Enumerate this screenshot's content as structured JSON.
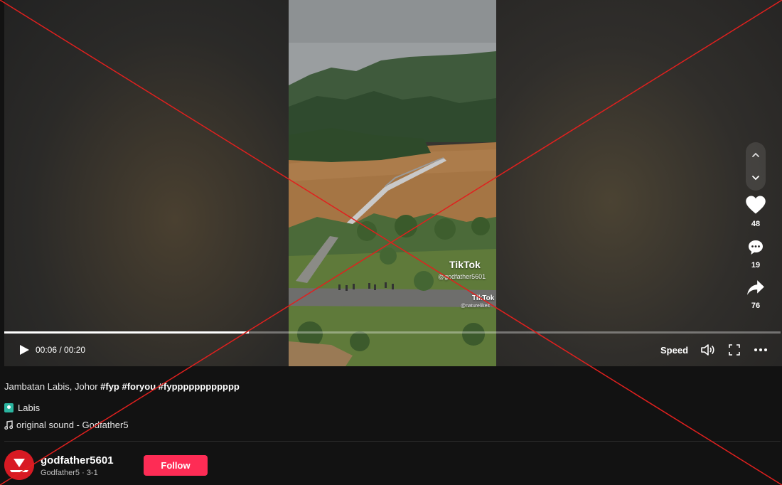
{
  "video": {
    "watermark_primary": "TikTok",
    "watermark_primary_handle": "@godfather5601",
    "watermark_secondary": "TikTok",
    "watermark_secondary_handle": "@naturelikeit",
    "progress_fraction": 0.315
  },
  "actions": {
    "likes": "48",
    "comments": "19",
    "shares": "76"
  },
  "controls": {
    "time": "00:06 / 00:20",
    "speed_label": "Speed"
  },
  "info": {
    "caption_text": "Jambatan Labis, Johor ",
    "hashtags": [
      "#fyp",
      "#foryou",
      "#fypppppppppppp"
    ],
    "location": "Labis",
    "sound": "original sound - Godfather5"
  },
  "author": {
    "username": "godfather5601",
    "subtitle": "Godfather5 · 3-1",
    "follow_label": "Follow"
  },
  "colors": {
    "accent": "#fe2c55",
    "location_pin": "#2bb5a0",
    "background": "#121212",
    "overlay_cross": "#e0201e"
  }
}
